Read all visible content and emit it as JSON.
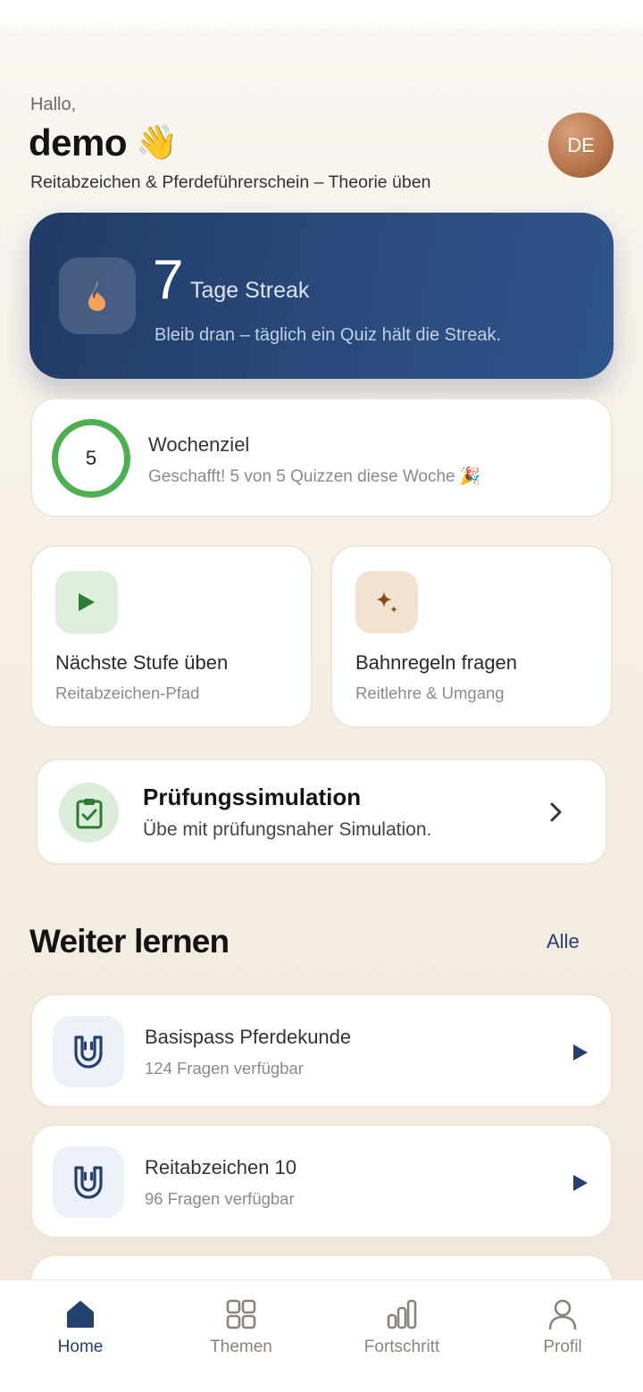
{
  "header": {
    "greeting": "Hallo,",
    "username": "demo",
    "wave_emoji": "👋",
    "subtitle": "Reitabzeichen & Pferdeführerschein – Theorie üben",
    "avatar_initials": "DE"
  },
  "streak": {
    "count": "7",
    "label": "Tage Streak",
    "hint": "Bleib dran – täglich ein Quiz hält die Streak.",
    "icon": "flame-icon"
  },
  "weekly_goal": {
    "value": "5",
    "title": "Wochenziel",
    "subtitle": "Geschafft! 5 von 5 Quizzen diese Woche 🎉",
    "progress": 1.0,
    "ring_color": "#4caf50"
  },
  "actions": [
    {
      "title": "Nächste Stufe üben",
      "subtitle": "Reitabzeichen-Pfad",
      "icon": "play-icon"
    },
    {
      "title": "Bahnregeln fragen",
      "subtitle": "Reitlehre & Umgang",
      "icon": "sparkle-icon"
    }
  ],
  "exam": {
    "title": "Prüfungssimulation",
    "subtitle": "Übe mit prüfungsnaher Simulation.",
    "icon": "clipboard-check-icon"
  },
  "continue_section": {
    "title": "Weiter lernen",
    "link": "Alle",
    "items": [
      {
        "title": "Basispass Pferdekunde",
        "subtitle": "124 Fragen verfügbar",
        "icon": "horseshoe-icon"
      },
      {
        "title": "Reitabzeichen 10",
        "subtitle": "96 Fragen verfügbar",
        "icon": "horseshoe-icon"
      }
    ]
  },
  "nav": {
    "items": [
      {
        "label": "Home",
        "icon": "home-icon",
        "active": true
      },
      {
        "label": "Themen",
        "icon": "grid-icon",
        "active": false
      },
      {
        "label": "Fortschritt",
        "icon": "bar-chart-icon",
        "active": false
      },
      {
        "label": "Profil",
        "icon": "user-icon",
        "active": false
      }
    ]
  },
  "colors": {
    "primary": "#23406e",
    "streak_bg": "#2b4a7b",
    "flame": "#f4a259",
    "success": "#4caf50",
    "accent_brown": "#8b4a1c"
  }
}
